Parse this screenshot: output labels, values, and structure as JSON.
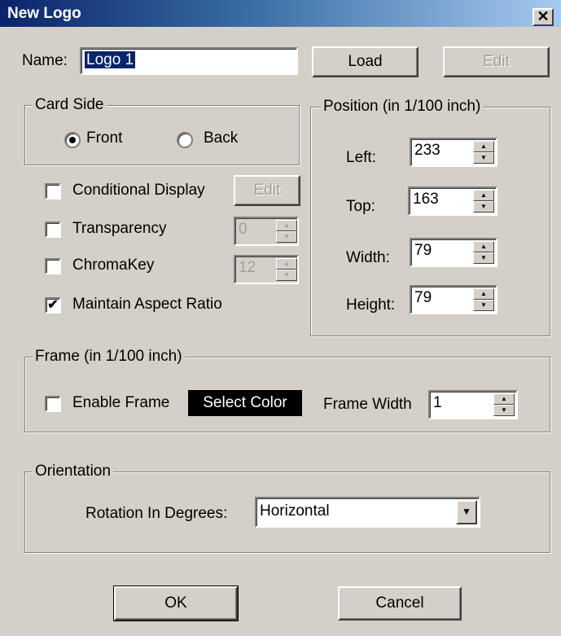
{
  "window": {
    "title": "New Logo",
    "close_glyph": "✕"
  },
  "name_field": {
    "label": "Name:",
    "value": "Logo 1"
  },
  "buttons": {
    "load": "Load",
    "edit_top": "Edit",
    "edit_conditional": "Edit",
    "ok": "OK",
    "cancel": "Cancel"
  },
  "card_side": {
    "legend": "Card Side",
    "front": "Front",
    "back": "Back",
    "selected": "Front"
  },
  "options": {
    "conditional_display": {
      "label": "Conditional Display",
      "checked": false
    },
    "transparency": {
      "label": "Transparency",
      "checked": false,
      "value": "0"
    },
    "chromakey": {
      "label": "ChromaKey",
      "checked": false,
      "value": "12"
    },
    "maintain_aspect": {
      "label": "Maintain Aspect Ratio",
      "checked": true,
      "mark": "✔"
    }
  },
  "position": {
    "legend": "Position (in 1/100 inch)",
    "left": {
      "label": "Left:",
      "value": "233"
    },
    "top": {
      "label": "Top:",
      "value": "163"
    },
    "width": {
      "label": "Width:",
      "value": "79"
    },
    "height": {
      "label": "Height:",
      "value": "79"
    }
  },
  "frame": {
    "legend": "Frame (in 1/100 inch)",
    "enable_label": "Enable Frame",
    "enable_checked": false,
    "select_color": "Select Color",
    "width_label": "Frame Width",
    "width_value": "1"
  },
  "orientation": {
    "legend": "Orientation",
    "rotation_label": "Rotation In Degrees:",
    "rotation_value": "Horizontal"
  },
  "glyphs": {
    "spin_up": "▲",
    "spin_down": "▼",
    "dropdown": "▼"
  }
}
